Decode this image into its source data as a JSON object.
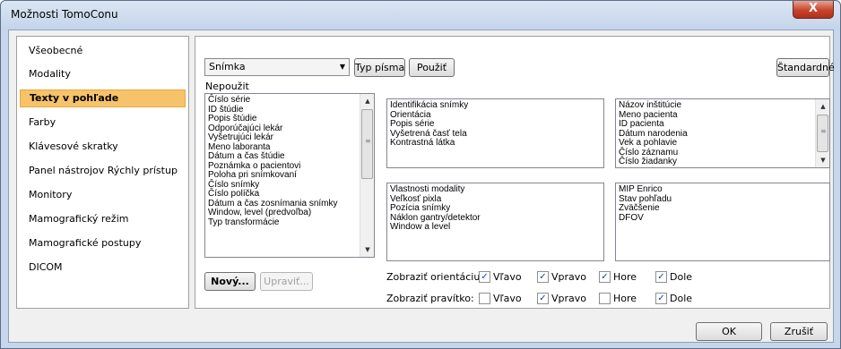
{
  "window": {
    "title": "Možnosti TomoConu",
    "close_symbol": "X"
  },
  "nav": {
    "items": [
      {
        "label": "Všeobecné",
        "selected": false
      },
      {
        "label": "Modality",
        "selected": false
      },
      {
        "label": "Texty v pohľade",
        "selected": true
      },
      {
        "label": "Farby",
        "selected": false
      },
      {
        "label": "Klávesové skratky",
        "selected": false
      },
      {
        "label": "Panel nástrojov Rýchly prístup",
        "selected": false
      },
      {
        "label": "Monitory",
        "selected": false
      },
      {
        "label": "Mamografický režim",
        "selected": false
      },
      {
        "label": "Mamografické postupy",
        "selected": false
      },
      {
        "label": "DICOM",
        "selected": false
      }
    ]
  },
  "toolbar": {
    "combo_value": "Snímka",
    "font_type_label": "Typ písma",
    "apply_label": "Použiť",
    "default_label": "Štandardné"
  },
  "unused": {
    "label": "Nepoužit",
    "items": [
      "Číslo série",
      "ID štúdie",
      "Popis štúdie",
      "Odporúčajúci lekár",
      "Vyšetrujúci lekár",
      "Meno laboranta",
      "Dátum a čas štúdie",
      "Poznámka o pacientovi",
      "Poloha pri snímkovaní",
      "Číslo snímky",
      "Číslo políčka",
      "Dátum a čas zosnímania snímky",
      "Window, level (predvoľba)",
      "Typ transformácie"
    ]
  },
  "top_left_list": {
    "items": [
      "Identifikácia snímky",
      "Orientácia",
      "Popis série",
      "Vyšetrená časť tela",
      "Kontrastná látka"
    ]
  },
  "top_right_list": {
    "items": [
      "Názov inštitúcie",
      "Meno pacienta",
      "ID pacienta",
      "Dátum narodenia",
      "Vek a pohlavie",
      "Číslo záznamu",
      "Číslo žiadanky"
    ]
  },
  "bottom_left_list": {
    "items": [
      "Vlastnosti modality",
      "Veľkosť pixla",
      "Pozícia snímky",
      "Náklon gantry/detektor",
      "Window a level"
    ]
  },
  "bottom_right_list": {
    "items": [
      "MIP Enrico",
      "Stav pohľadu",
      "Zväčšenie",
      "DFOV"
    ]
  },
  "item_buttons": {
    "new_label": "Nový...",
    "edit_label": "Upraviť..."
  },
  "show_orientation": {
    "label": "Zobraziť orientáciu:",
    "options": [
      {
        "label": "Vľavo",
        "checked": true
      },
      {
        "label": "Vpravo",
        "checked": true
      },
      {
        "label": "Hore",
        "checked": true
      },
      {
        "label": "Dole",
        "checked": true
      }
    ]
  },
  "show_ruler": {
    "label": "Zobraziť pravítko:",
    "options": [
      {
        "label": "Vľavo",
        "checked": false
      },
      {
        "label": "Vpravo",
        "checked": true
      },
      {
        "label": "Hore",
        "checked": false
      },
      {
        "label": "Dole",
        "checked": true
      }
    ]
  },
  "footer": {
    "ok_label": "OK",
    "cancel_label": "Zrušiť"
  }
}
